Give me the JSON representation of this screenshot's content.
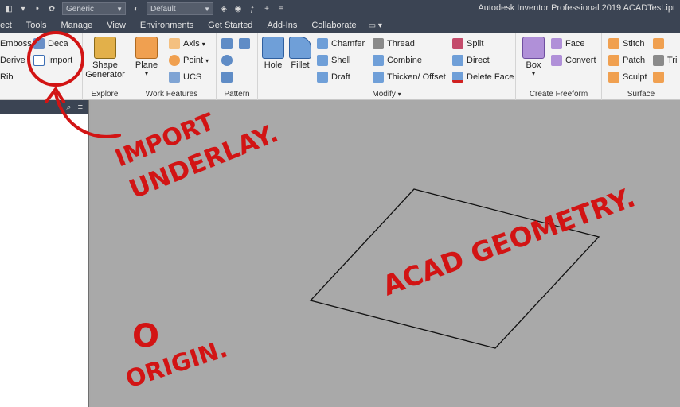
{
  "titlebar": {
    "appearance_dropdown": "Generic",
    "material_dropdown": "Default",
    "title": "Autodesk Inventor Professional 2019   ACADTest.ipt"
  },
  "menubar": {
    "items": [
      "pect",
      "Tools",
      "Manage",
      "View",
      "Environments",
      "Get Started",
      "Add-Ins",
      "Collaborate"
    ]
  },
  "ribbon": {
    "create": {
      "emboss": "Emboss",
      "decal": "Deca",
      "derive": "Derive",
      "import": "Import",
      "rib": "Rib"
    },
    "explore": {
      "shape_generator_1": "Shape",
      "shape_generator_2": "Generator",
      "label": "Explore"
    },
    "work_features": {
      "plane": "Plane",
      "axis": "Axis",
      "point": "Point",
      "ucs": "UCS",
      "label": "Work Features"
    },
    "pattern": {
      "label": "Pattern"
    },
    "modify": {
      "hole": "Hole",
      "fillet": "Fillet",
      "chamfer": "Chamfer",
      "shell": "Shell",
      "draft": "Draft",
      "thread": "Thread",
      "combine": "Combine",
      "thicken": "Thicken/ Offset",
      "split": "Split",
      "direct": "Direct",
      "delete_face": "Delete Face",
      "label": "Modify"
    },
    "create_freeform": {
      "box": "Box",
      "face": "Face",
      "convert": "Convert",
      "label": "Create Freeform"
    },
    "surface": {
      "stitch": "Stitch",
      "patch": "Patch",
      "sculpt": "Sculpt",
      "trim": "Tri",
      "label": "Surface"
    }
  },
  "annotations": {
    "import_note_1": "IMPORT",
    "import_note_2": "UNDERLAY.",
    "geometry_note": "ACAD GEOMETRY.",
    "origin_note_1": "O",
    "origin_note_2": "ORIGIN."
  },
  "colors": {
    "annotation": "#d21414",
    "viewport": "#a9a9a9",
    "titlebar": "#3b4453"
  }
}
